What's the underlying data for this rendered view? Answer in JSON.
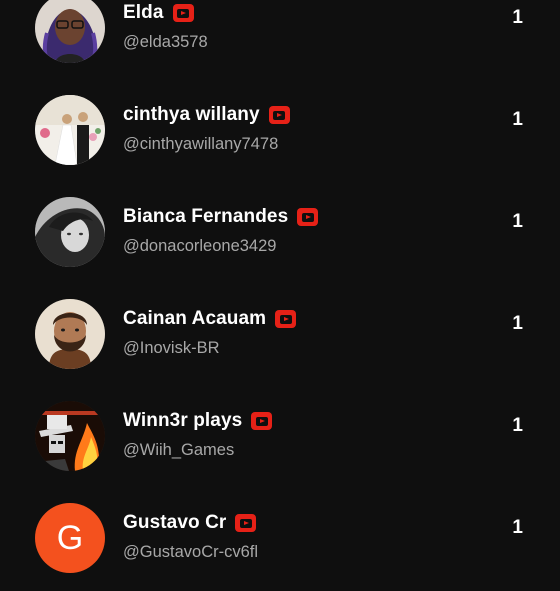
{
  "colors": {
    "background": "#0f0f0f",
    "name": "#ffffff",
    "handle": "#a8a8a8",
    "badge": "#e62117",
    "letter_avatar": "#f4511e"
  },
  "badge_icon": "youtube-play-icon",
  "users": [
    {
      "name": "Elda",
      "handle": "@elda3578",
      "count": "1",
      "avatar": "photo"
    },
    {
      "name": "cinthya willany",
      "handle": "@cinthyawillany7478",
      "count": "1",
      "avatar": "photo"
    },
    {
      "name": "Bianca Fernandes",
      "handle": "@donacorleone3429",
      "count": "1",
      "avatar": "photo"
    },
    {
      "name": "Cainan Acauam",
      "handle": "@Inovisk-BR",
      "count": "1",
      "avatar": "photo"
    },
    {
      "name": "Winn3r plays",
      "handle": "@Wiih_Games",
      "count": "1",
      "avatar": "photo"
    },
    {
      "name": "Gustavo Cr",
      "handle": "@GustavoCr-cv6fl",
      "count": "1",
      "avatar": "letter",
      "avatar_letter": "G"
    }
  ]
}
